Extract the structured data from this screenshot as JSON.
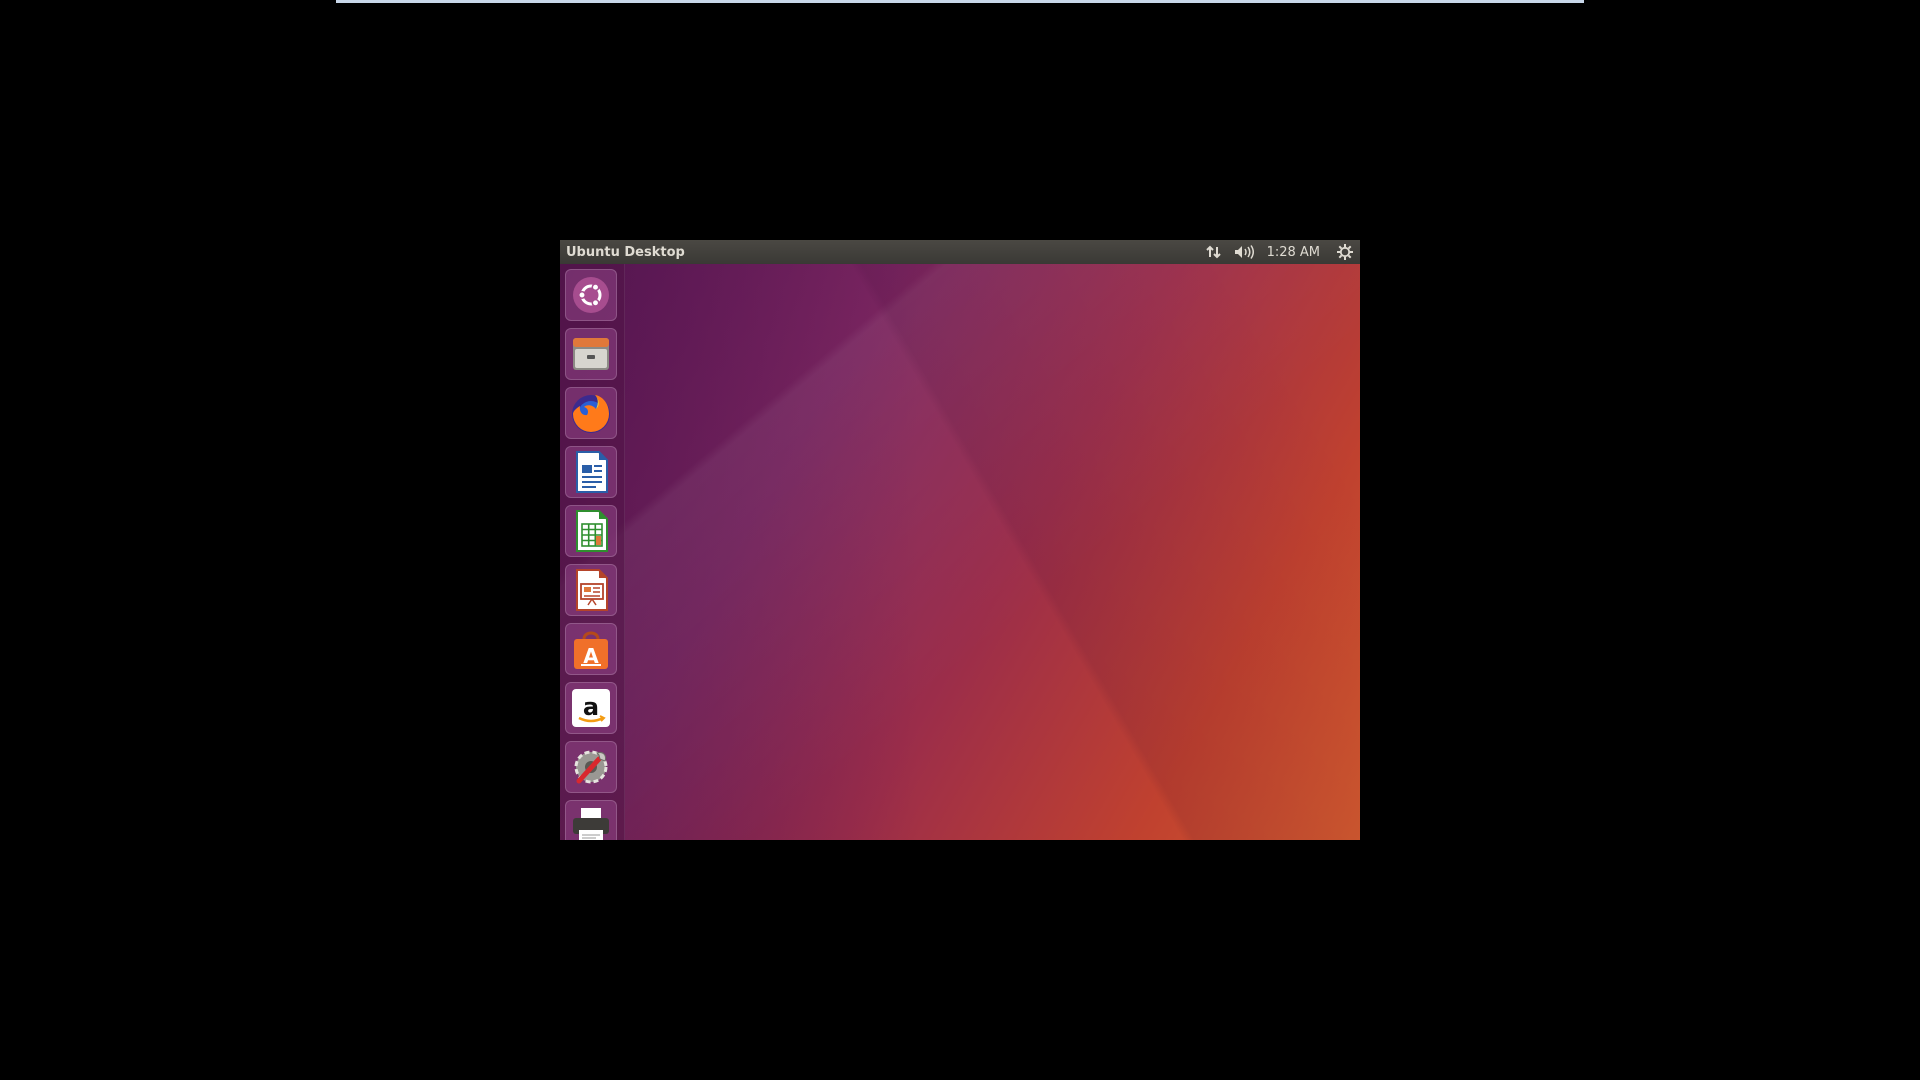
{
  "panel": {
    "title": "Ubuntu Desktop",
    "clock": "1:28 AM"
  },
  "launcher": {
    "items": [
      {
        "name": "dash-home",
        "icon": "ubuntu-logo-icon"
      },
      {
        "name": "files",
        "icon": "file-cabinet-icon"
      },
      {
        "name": "firefox",
        "icon": "firefox-icon"
      },
      {
        "name": "libreoffice-writer",
        "icon": "writer-icon"
      },
      {
        "name": "libreoffice-calc",
        "icon": "calc-icon"
      },
      {
        "name": "libreoffice-impress",
        "icon": "impress-icon"
      },
      {
        "name": "ubuntu-software",
        "icon": "software-bag-icon"
      },
      {
        "name": "amazon",
        "icon": "amazon-icon"
      },
      {
        "name": "system-settings",
        "icon": "settings-tools-icon"
      },
      {
        "name": "printer",
        "icon": "printer-icon"
      }
    ]
  },
  "colors": {
    "panel_bg": "#3c3b37",
    "wallpaper_left": "#5e1a5a",
    "wallpaper_right": "#d35a2e"
  }
}
